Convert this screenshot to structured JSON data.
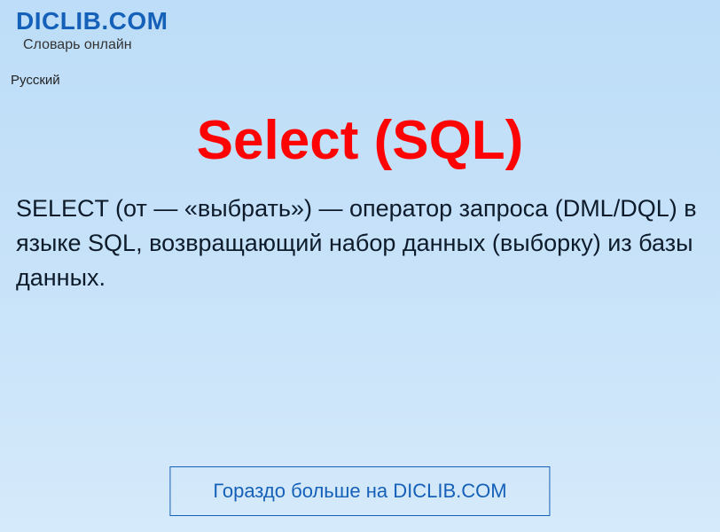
{
  "header": {
    "site_name": "DICLIB.COM",
    "tagline": "Словарь онлайн"
  },
  "language": "Русский",
  "article": {
    "title": "Select (SQL)",
    "description": "SELECT (от  — «выбрать») — оператор запроса (DML/DQL) в языке SQL, возвращающий набор данных (выборку) из базы данных."
  },
  "footer": {
    "more_label": "Гораздо больше на DICLIB.COM"
  }
}
